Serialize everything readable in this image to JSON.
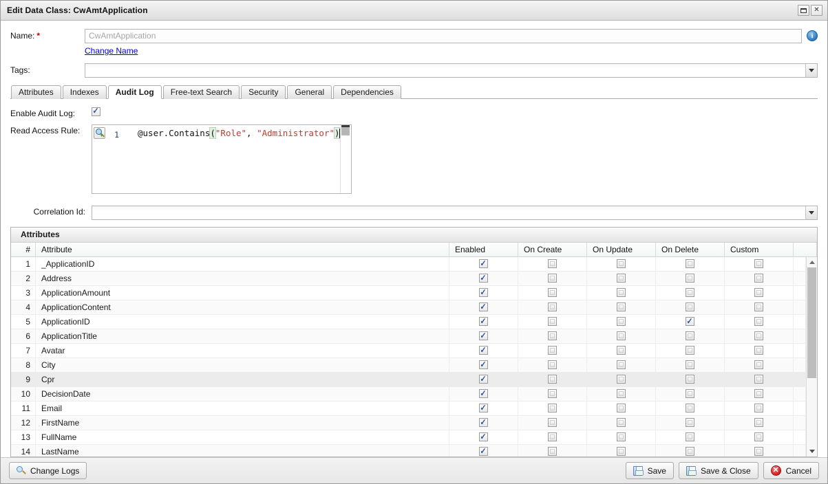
{
  "window": {
    "title": "Edit Data Class: CwAmtApplication",
    "maximize_icon": "restore-icon",
    "close_icon": "close-icon"
  },
  "form": {
    "name_label": "Name:",
    "name_required_marker": "*",
    "name_value": "CwAmtApplication",
    "change_name_link": "Change Name",
    "info_icon_glyph": "i",
    "tags_label": "Tags:",
    "tags_value": ""
  },
  "tabs": [
    {
      "label": "Attributes",
      "active": false
    },
    {
      "label": "Indexes",
      "active": false
    },
    {
      "label": "Audit Log",
      "active": true
    },
    {
      "label": "Free-text Search",
      "active": false
    },
    {
      "label": "Security",
      "active": false
    },
    {
      "label": "General",
      "active": false
    },
    {
      "label": "Dependencies",
      "active": false
    }
  ],
  "audit_log": {
    "enable_label": "Enable Audit Log:",
    "enable_checked": true,
    "read_access_label": "Read Access Rule:",
    "code": {
      "line_number": "1",
      "expression_prefix": "@user.Contains",
      "open_paren": "(",
      "arg1": "\"Role\"",
      "comma": ", ",
      "arg2": "\"Administrator\"",
      "close_paren": ")",
      "gutter_icon": "zoom-in-icon"
    },
    "correlation_label": "Correlation Id:",
    "correlation_value": ""
  },
  "grid": {
    "caption": "Attributes",
    "columns": [
      "#",
      "Attribute",
      "Enabled",
      "On Create",
      "On Update",
      "On Delete",
      "Custom"
    ],
    "rows": [
      {
        "num": "1",
        "attribute": "_ApplicationID",
        "enabled": true,
        "on_create": false,
        "on_update": false,
        "on_delete": false,
        "custom": false,
        "selected": false
      },
      {
        "num": "2",
        "attribute": "Address",
        "enabled": true,
        "on_create": false,
        "on_update": false,
        "on_delete": false,
        "custom": false,
        "selected": false
      },
      {
        "num": "3",
        "attribute": "ApplicationAmount",
        "enabled": true,
        "on_create": false,
        "on_update": false,
        "on_delete": false,
        "custom": false,
        "selected": false
      },
      {
        "num": "4",
        "attribute": "ApplicationContent",
        "enabled": true,
        "on_create": false,
        "on_update": false,
        "on_delete": false,
        "custom": false,
        "selected": false
      },
      {
        "num": "5",
        "attribute": "ApplicationID",
        "enabled": true,
        "on_create": false,
        "on_update": false,
        "on_delete": true,
        "custom": false,
        "selected": false
      },
      {
        "num": "6",
        "attribute": "ApplicationTitle",
        "enabled": true,
        "on_create": false,
        "on_update": false,
        "on_delete": false,
        "custom": false,
        "selected": false
      },
      {
        "num": "7",
        "attribute": "Avatar",
        "enabled": true,
        "on_create": false,
        "on_update": false,
        "on_delete": false,
        "custom": false,
        "selected": false
      },
      {
        "num": "8",
        "attribute": "City",
        "enabled": true,
        "on_create": false,
        "on_update": false,
        "on_delete": false,
        "custom": false,
        "selected": false
      },
      {
        "num": "9",
        "attribute": "Cpr",
        "enabled": true,
        "on_create": false,
        "on_update": false,
        "on_delete": false,
        "custom": false,
        "selected": true
      },
      {
        "num": "10",
        "attribute": "DecisionDate",
        "enabled": true,
        "on_create": false,
        "on_update": false,
        "on_delete": false,
        "custom": false,
        "selected": false
      },
      {
        "num": "11",
        "attribute": "Email",
        "enabled": true,
        "on_create": false,
        "on_update": false,
        "on_delete": false,
        "custom": false,
        "selected": false
      },
      {
        "num": "12",
        "attribute": "FirstName",
        "enabled": true,
        "on_create": false,
        "on_update": false,
        "on_delete": false,
        "custom": false,
        "selected": false
      },
      {
        "num": "13",
        "attribute": "FullName",
        "enabled": true,
        "on_create": false,
        "on_update": false,
        "on_delete": false,
        "custom": false,
        "selected": false
      },
      {
        "num": "14",
        "attribute": "LastName",
        "enabled": true,
        "on_create": false,
        "on_update": false,
        "on_delete": false,
        "custom": false,
        "selected": false
      }
    ]
  },
  "footer": {
    "change_logs": "Change Logs",
    "save": "Save",
    "save_and_close": "Save & Close",
    "cancel": "Cancel",
    "cancel_glyph": "✕"
  },
  "colors": {
    "link": "#0000cc",
    "required": "#cc0000",
    "string_literal": "#c23a31",
    "checkbox_tick": "#2d4f9e",
    "selected_row": "#ececec"
  }
}
